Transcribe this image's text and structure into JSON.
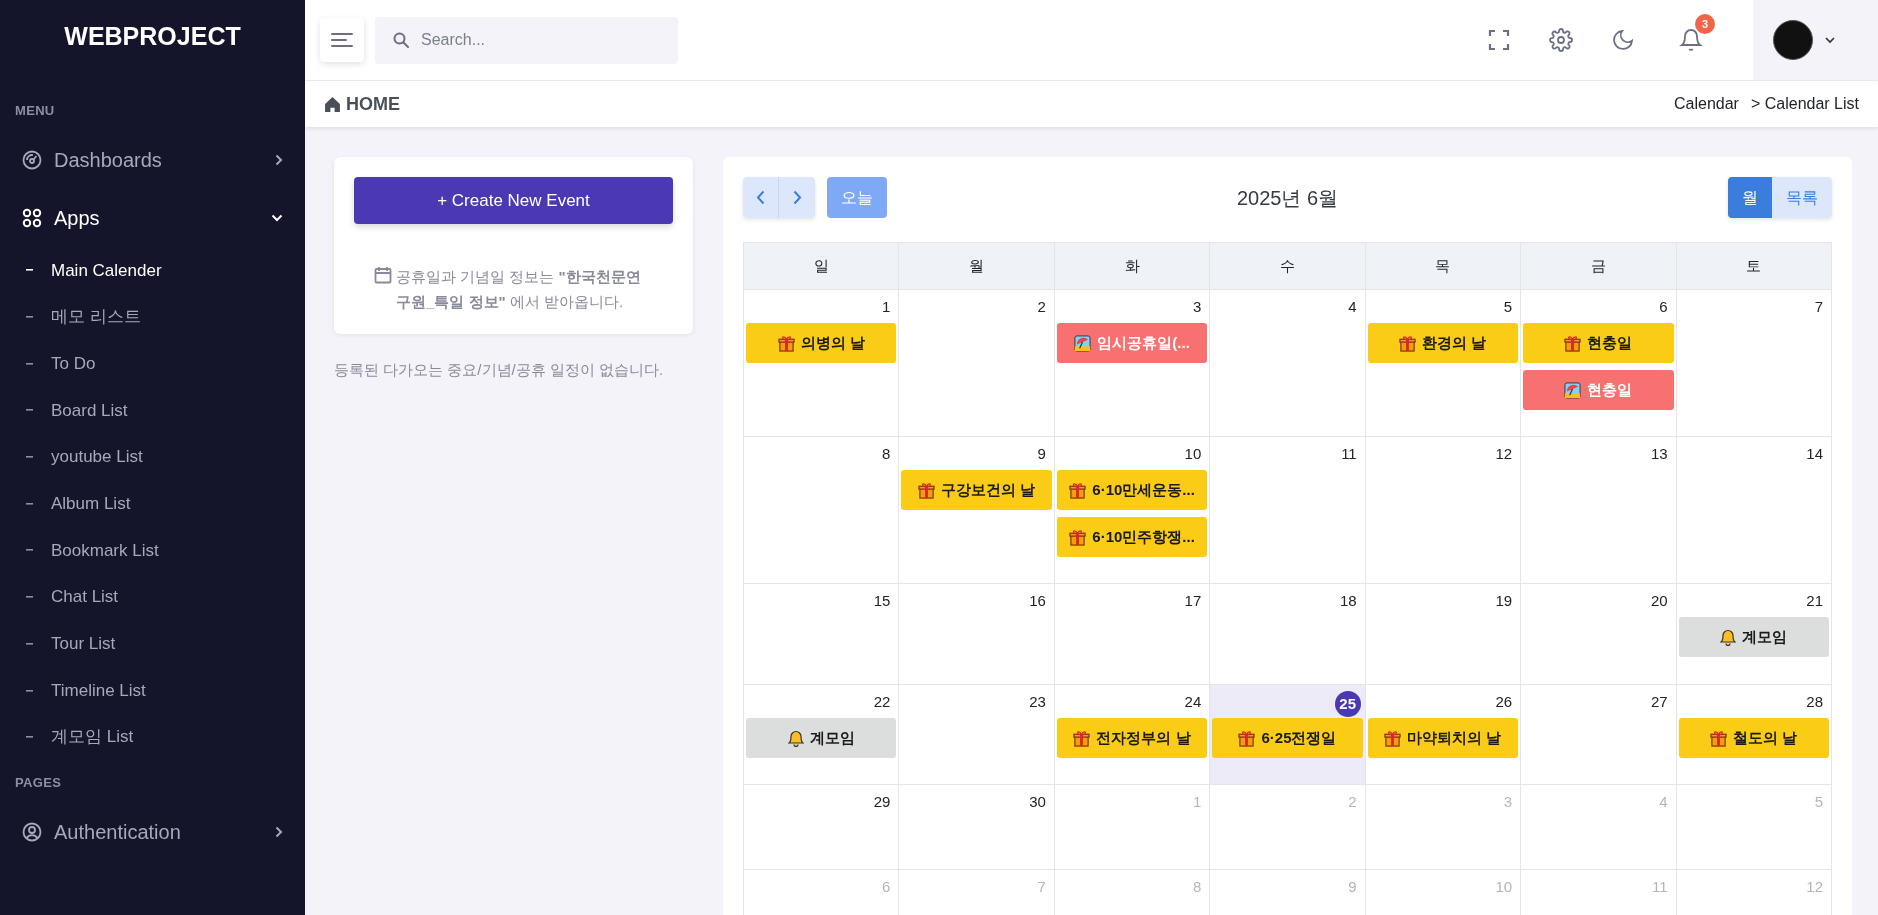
{
  "sidebar": {
    "brand": "WEBPROJECT",
    "sections": [
      {
        "label": "MENU",
        "items": [
          {
            "label": "Dashboards",
            "expanded": false
          },
          {
            "label": "Apps",
            "expanded": true,
            "children": [
              {
                "label": "Main Calender",
                "selected": true
              },
              {
                "label": "메모 리스트",
                "selected": false
              },
              {
                "label": "To Do",
                "selected": false
              },
              {
                "label": "Board List",
                "selected": false
              },
              {
                "label": "youtube List",
                "selected": false
              },
              {
                "label": "Album List",
                "selected": false
              },
              {
                "label": "Bookmark List",
                "selected": false
              },
              {
                "label": "Chat List",
                "selected": false
              },
              {
                "label": "Tour List",
                "selected": false
              },
              {
                "label": "Timeline List",
                "selected": false
              },
              {
                "label": "계모임 List",
                "selected": false
              }
            ]
          }
        ]
      },
      {
        "label": "PAGES",
        "items": [
          {
            "label": "Authentication",
            "expanded": false
          }
        ]
      }
    ]
  },
  "topbar": {
    "search": {
      "placeholder": "Search..."
    },
    "notifications": "3"
  },
  "breadcrumb": {
    "title": "HOME",
    "path": [
      "Calendar",
      "> Calendar List"
    ]
  },
  "left_panel": {
    "create_button": "+ Create New Event",
    "info": "공휴일과 기념일 정보는 **\"한국천문연구원_특일 정보\"** 에서 받아옵니다.",
    "empty_message": "등록된 다가오는 중요/기념/공휴 일정이 없습니다."
  },
  "calendar": {
    "today_button": "오늘",
    "title": "2025년 6월",
    "views": [
      {
        "label": "월",
        "selected": true
      },
      {
        "label": "목록",
        "selected": false
      }
    ],
    "weekdays": [
      "일",
      "월",
      "화",
      "수",
      "목",
      "금",
      "토"
    ],
    "weeks": [
      [
        {
          "day": "1",
          "outside_month": false,
          "today": false,
          "events": [
            {
              "kind": "holiday",
              "title": "의병의 날"
            }
          ]
        },
        {
          "day": "2",
          "outside_month": false,
          "today": false
        },
        {
          "day": "3",
          "outside_month": false,
          "today": false,
          "events": [
            {
              "kind": "day_off",
              "title": "임시공휴일(..."
            }
          ]
        },
        {
          "day": "4",
          "outside_month": false,
          "today": false
        },
        {
          "day": "5",
          "outside_month": false,
          "today": false,
          "events": [
            {
              "kind": "holiday",
              "title": "환경의 날"
            }
          ]
        },
        {
          "day": "6",
          "outside_month": false,
          "today": false,
          "events": [
            {
              "kind": "holiday",
              "title": "현충일"
            },
            {
              "kind": "day_off",
              "title": "현충일"
            }
          ]
        },
        {
          "day": "7",
          "outside_month": false,
          "today": false
        }
      ],
      [
        {
          "day": "8",
          "outside_month": false,
          "today": false
        },
        {
          "day": "9",
          "outside_month": false,
          "today": false,
          "events": [
            {
              "kind": "holiday",
              "title": "구강보건의 날"
            }
          ]
        },
        {
          "day": "10",
          "outside_month": false,
          "today": false,
          "events": [
            {
              "kind": "holiday",
              "title": "6·10만세운동..."
            },
            {
              "kind": "holiday",
              "title": "6·10민주항쟁..."
            }
          ]
        },
        {
          "day": "11",
          "outside_month": false,
          "today": false
        },
        {
          "day": "12",
          "outside_month": false,
          "today": false
        },
        {
          "day": "13",
          "outside_month": false,
          "today": false
        },
        {
          "day": "14",
          "outside_month": false,
          "today": false
        }
      ],
      [
        {
          "day": "15",
          "outside_month": false,
          "today": false
        },
        {
          "day": "16",
          "outside_month": false,
          "today": false
        },
        {
          "day": "17",
          "outside_month": false,
          "today": false
        },
        {
          "day": "18",
          "outside_month": false,
          "today": false
        },
        {
          "day": "19",
          "outside_month": false,
          "today": false
        },
        {
          "day": "20",
          "outside_month": false,
          "today": false
        },
        {
          "day": "21",
          "outside_month": false,
          "today": false,
          "events": [
            {
              "kind": "meeting",
              "title": "계모임"
            }
          ]
        }
      ],
      [
        {
          "day": "22",
          "outside_month": false,
          "today": false,
          "events": [
            {
              "kind": "meeting",
              "title": "계모임"
            }
          ]
        },
        {
          "day": "23",
          "outside_month": false,
          "today": false
        },
        {
          "day": "24",
          "outside_month": false,
          "today": false,
          "events": [
            {
              "kind": "holiday",
              "title": "전자정부의 날"
            }
          ]
        },
        {
          "day": "25",
          "outside_month": false,
          "today": true,
          "events": [
            {
              "kind": "holiday",
              "title": "6·25전쟁일"
            }
          ]
        },
        {
          "day": "26",
          "outside_month": false,
          "today": false,
          "events": [
            {
              "kind": "holiday",
              "title": "마약퇴치의 날"
            }
          ]
        },
        {
          "day": "27",
          "outside_month": false,
          "today": false
        },
        {
          "day": "28",
          "outside_month": false,
          "today": false,
          "events": [
            {
              "kind": "holiday",
              "title": "철도의 날"
            }
          ]
        }
      ],
      [
        {
          "day": "29",
          "outside_month": false,
          "today": false
        },
        {
          "day": "30",
          "outside_month": false,
          "today": false
        },
        {
          "day": "1",
          "outside_month": true,
          "today": false
        },
        {
          "day": "2",
          "outside_month": true,
          "today": false
        },
        {
          "day": "3",
          "outside_month": true,
          "today": false
        },
        {
          "day": "4",
          "outside_month": true,
          "today": false
        },
        {
          "day": "5",
          "outside_month": true,
          "today": false
        }
      ],
      [
        {
          "day": "6",
          "outside_month": true,
          "today": false
        },
        {
          "day": "7",
          "outside_month": true,
          "today": false
        },
        {
          "day": "8",
          "outside_month": true,
          "today": false
        },
        {
          "day": "9",
          "outside_month": true,
          "today": false
        },
        {
          "day": "10",
          "outside_month": true,
          "today": false
        },
        {
          "day": "11",
          "outside_month": true,
          "today": false
        },
        {
          "day": "12",
          "outside_month": true,
          "today": false
        }
      ]
    ]
  }
}
